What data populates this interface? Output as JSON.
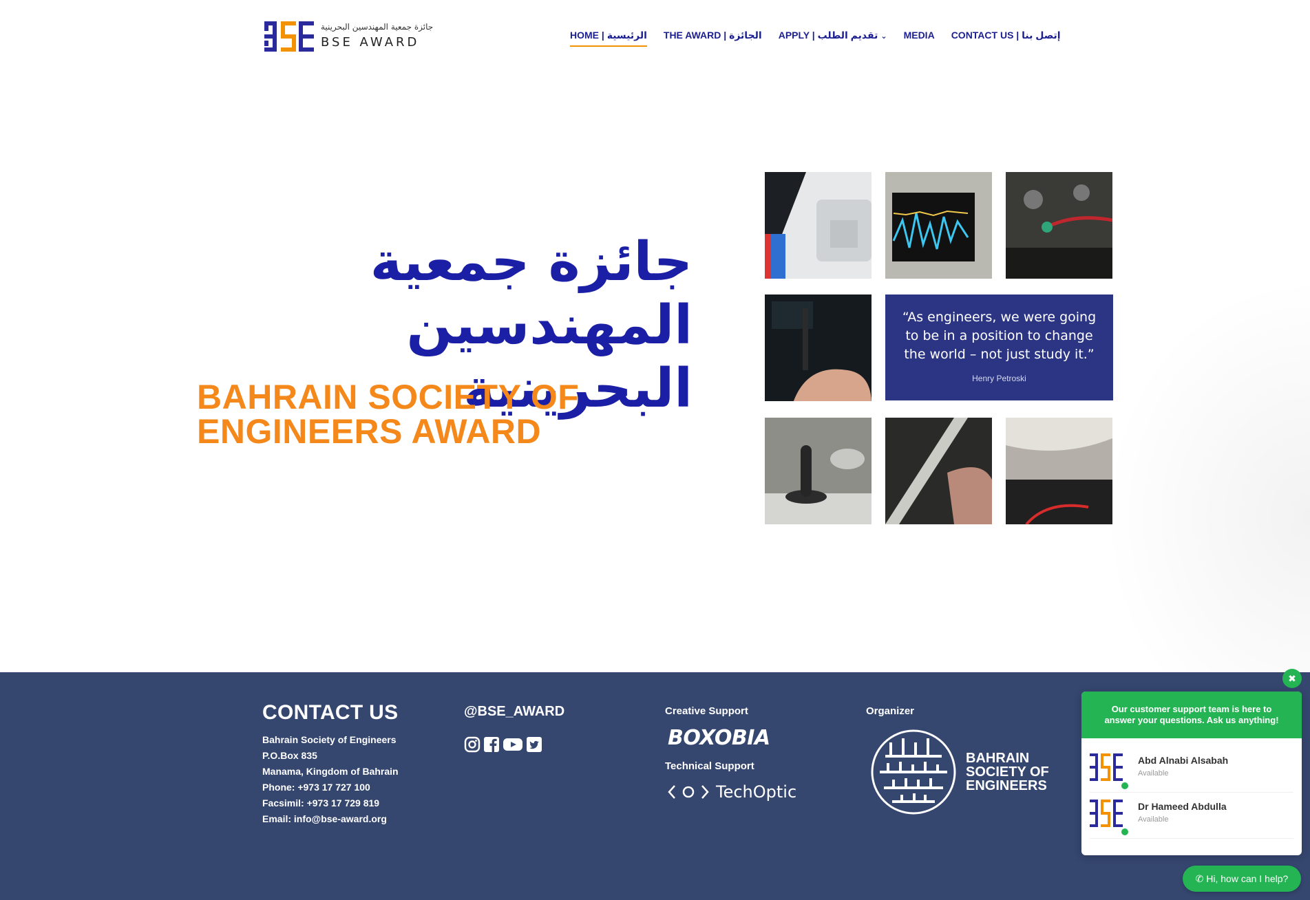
{
  "header": {
    "logo": {
      "arabic": "جائزة جمعية المهندسين البحرينية",
      "english": "BSE AWARD"
    },
    "nav": [
      {
        "label": "HOME | الرئيسية",
        "active": true
      },
      {
        "label": "THE AWARD | الجائزة",
        "active": false
      },
      {
        "label": "APPLY | تقديم الطلب",
        "active": false,
        "has_dropdown": true
      },
      {
        "label": "MEDIA",
        "active": false
      },
      {
        "label": "CONTACT US | إتصل بنا",
        "active": false
      }
    ]
  },
  "hero": {
    "arabic_title": "جائزة جمعية المهندسين البحرينية",
    "english_title": "BAHRAIN SOCIETY OF ENGINEERS AWARD"
  },
  "quote": {
    "text": "“As engineers, we were going to be in a position to change the world – not just study it.”",
    "author": "Henry Petroski"
  },
  "footer": {
    "contact": {
      "title": "CONTACT US",
      "lines": [
        "Bahrain Society of Engineers",
        "P.O.Box 835",
        "Manama, Kingdom of Bahrain",
        "Phone: +973 17 727 100",
        "Facsimil: +973 17 729 819",
        "Email: info@bse-award.org"
      ]
    },
    "social": {
      "handle": "@BSE_AWARD",
      "icons": [
        "instagram-icon",
        "facebook-icon",
        "youtube-icon",
        "twitter-icon"
      ]
    },
    "creative_support": {
      "label": "Creative Support",
      "brand": "BOXOBIA"
    },
    "technical_support": {
      "label": "Technical Support",
      "brand": "TechOptic"
    },
    "organizer": {
      "label": "Organizer",
      "name_lines": [
        "BAHRAIN",
        "SOCIETY OF",
        "ENGINEERS"
      ]
    }
  },
  "chat": {
    "intro": "Our customer support team is here to answer your questions. Ask us anything!",
    "agents": [
      {
        "name": "Abd Alnabi Alsabah",
        "status": "Available"
      },
      {
        "name": "Dr Hameed Abdulla",
        "status": "Available"
      }
    ],
    "button_label": "Hi, how can I help?"
  },
  "colors": {
    "brand_blue": "#1b1fa5",
    "brand_orange": "#f4881b",
    "footer_bg": "#35466f",
    "quote_bg": "#2b3584",
    "whatsapp_green": "#25b453"
  }
}
